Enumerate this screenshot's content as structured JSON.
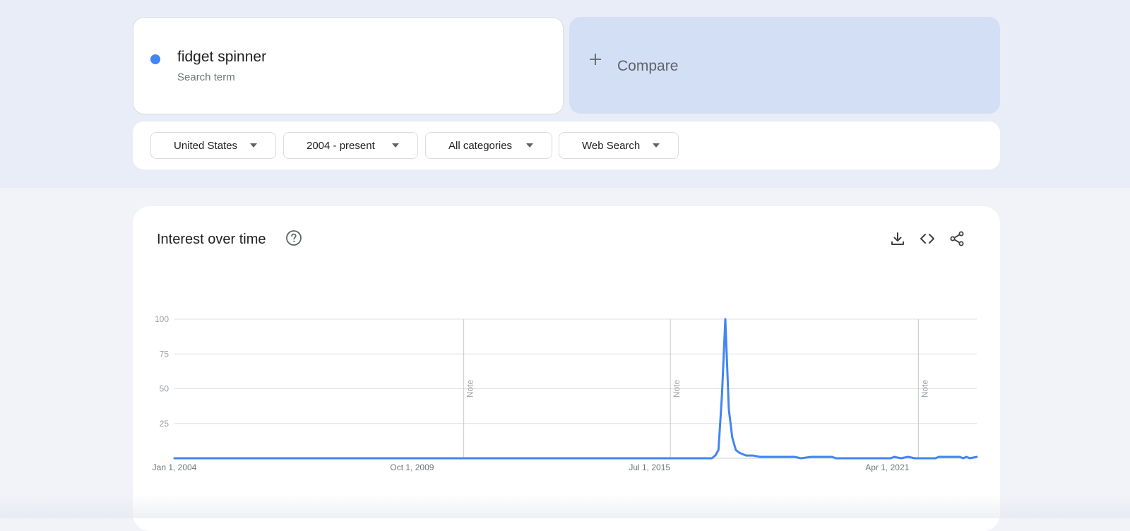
{
  "search": {
    "term": "fidget spinner",
    "term_type": "Search term",
    "term_color": "#4285f4",
    "compare_label": "Compare",
    "compare_icon": "plus-icon"
  },
  "filters": {
    "region": "United States",
    "time_range": "2004 - present",
    "category": "All categories",
    "property": "Web Search"
  },
  "card": {
    "title": "Interest over time",
    "icons": [
      "help-icon",
      "download-icon",
      "embed-code-icon",
      "share-icon"
    ]
  },
  "chart_data": {
    "type": "line",
    "title": "Interest over time",
    "xlabel": "",
    "ylabel": "",
    "ylim": [
      0,
      100
    ],
    "yticks": [
      25,
      50,
      75,
      100
    ],
    "xlim": [
      "2004-01-01",
      "2023-06-01"
    ],
    "x_tick_labels": [
      {
        "date": "2004-01-01",
        "label": "Jan 1, 2004"
      },
      {
        "date": "2009-10-01",
        "label": "Oct 1, 2009"
      },
      {
        "date": "2015-07-01",
        "label": "Jul 1, 2015"
      },
      {
        "date": "2021-04-01",
        "label": "Apr 1, 2021"
      }
    ],
    "annotations": [
      {
        "date": "2011-01-01",
        "label": "Note"
      },
      {
        "date": "2016-01-01",
        "label": "Note"
      },
      {
        "date": "2022-01-01",
        "label": "Note"
      }
    ],
    "grid": true,
    "series": [
      {
        "name": "fidget spinner",
        "color": "#4285f4",
        "points": [
          [
            "2004-01-01",
            0
          ],
          [
            "2017-01-01",
            0
          ],
          [
            "2017-02-01",
            2
          ],
          [
            "2017-03-01",
            6
          ],
          [
            "2017-04-01",
            45
          ],
          [
            "2017-05-01",
            100
          ],
          [
            "2017-06-01",
            35
          ],
          [
            "2017-07-01",
            15
          ],
          [
            "2017-08-01",
            6
          ],
          [
            "2017-09-01",
            4
          ],
          [
            "2017-10-01",
            3
          ],
          [
            "2017-11-01",
            2
          ],
          [
            "2018-01-01",
            2
          ],
          [
            "2018-03-01",
            1
          ],
          [
            "2018-06-01",
            1
          ],
          [
            "2019-01-01",
            1
          ],
          [
            "2019-03-01",
            0
          ],
          [
            "2019-06-01",
            1
          ],
          [
            "2019-12-01",
            1
          ],
          [
            "2020-01-01",
            0
          ],
          [
            "2021-05-01",
            0
          ],
          [
            "2021-06-01",
            1
          ],
          [
            "2021-08-01",
            0
          ],
          [
            "2021-10-01",
            1
          ],
          [
            "2021-12-01",
            0
          ],
          [
            "2022-06-01",
            0
          ],
          [
            "2022-07-01",
            1
          ],
          [
            "2023-01-01",
            1
          ],
          [
            "2023-02-01",
            0
          ],
          [
            "2023-03-01",
            1
          ],
          [
            "2023-04-01",
            0
          ],
          [
            "2023-06-01",
            1
          ]
        ]
      }
    ]
  }
}
